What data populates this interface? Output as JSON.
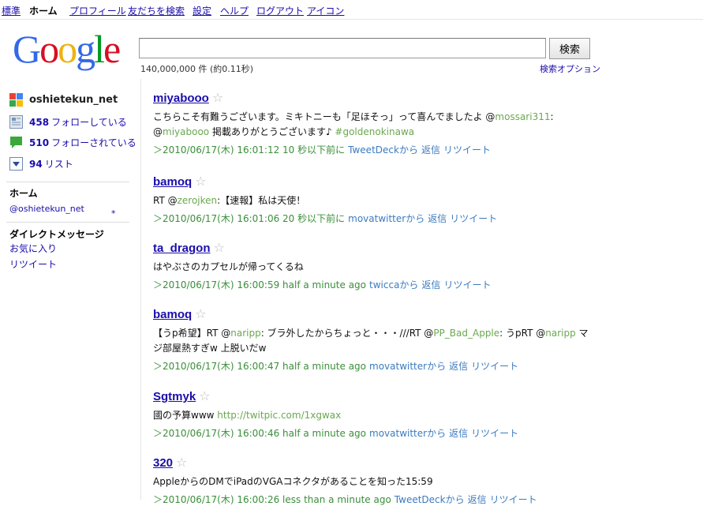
{
  "topnav": [
    "標準",
    "ホーム",
    "プロフィール",
    "友だちを検索",
    "設定",
    "ヘルプ",
    "ログアウト",
    "アイコン"
  ],
  "logo": {
    "letters": [
      "G",
      "o",
      "o",
      "g",
      "l",
      "e"
    ],
    "colors": [
      "#3369e8",
      "#d50f25",
      "#eeb211",
      "#3369e8",
      "#009925",
      "#d50f25"
    ]
  },
  "search": {
    "button": "検索",
    "result_count": "140,000,000 件 (約0.11秒)",
    "options": "検索オプション"
  },
  "sidebar": {
    "username": "oshietekun_net",
    "following_count": "458",
    "following_label": "フォローしている",
    "followers_count": "510",
    "followers_label": "フォローされている",
    "lists_count": "94",
    "lists_label": "リスト",
    "home_head": "ホーム",
    "home_sub": "@oshietekun_net",
    "asterisk": "*",
    "dm_head": "ダイレクトメッセージ",
    "favorites": "お気に入り",
    "retweets": "リツイート"
  },
  "tweets": [
    {
      "user": "miyabooo",
      "text": [
        {
          "t": "こちらこそ有難うございます。ミキトニーも「足ほそっ」って喜んでましたよ @"
        },
        {
          "t": "mossari311",
          "m": 1
        },
        {
          "t": ": @"
        },
        {
          "t": "miyabooo",
          "m": 1
        },
        {
          "t": " 掲載ありがとうございます♪ "
        },
        {
          "t": "#goldenokinawa",
          "m": 1
        }
      ],
      "meta": "＞2010/06/17(木) 16:01:12 10 秒以下前に",
      "source": "TweetDeckから",
      "reply": "返信",
      "retweet": "リツイート"
    },
    {
      "user": "bamoq",
      "text": [
        {
          "t": "RT @"
        },
        {
          "t": "zerojken",
          "m": 1
        },
        {
          "t": ":【速報】私は天使！"
        }
      ],
      "meta": "＞2010/06/17(木) 16:01:06 20 秒以下前に",
      "source": "movatwitterから",
      "reply": "返信",
      "retweet": "リツイート"
    },
    {
      "user": "ta_dragon",
      "text": [
        {
          "t": "はやぶさのカプセルが帰ってくるね"
        }
      ],
      "meta": "＞2010/06/17(木) 16:00:59 half a minute ago",
      "source": "twiccaから",
      "reply": "返信",
      "retweet": "リツイート"
    },
    {
      "user": "bamoq",
      "text": [
        {
          "t": "【うp希望】RT @"
        },
        {
          "t": "naripp",
          "m": 1
        },
        {
          "t": ": ブラ外したからちょっと・・・///RT @"
        },
        {
          "t": "PP_Bad_Apple",
          "m": 1
        },
        {
          "t": ": うpRT @"
        },
        {
          "t": "naripp",
          "m": 1
        },
        {
          "t": " マジ部屋熱すぎw 上脱いだw"
        }
      ],
      "meta": "＞2010/06/17(木) 16:00:47 half a minute ago",
      "source": "movatwitterから",
      "reply": "返信",
      "retweet": "リツイート"
    },
    {
      "user": "Sgtmyk",
      "text": [
        {
          "t": "國の予算www "
        },
        {
          "t": "http://twitpic.com/1xgwax",
          "m": 1
        }
      ],
      "meta": "＞2010/06/17(木) 16:00:46 half a minute ago",
      "source": "movatwitterから",
      "reply": "返信",
      "retweet": "リツイート"
    },
    {
      "user": "320",
      "text": [
        {
          "t": "AppleからのDMでiPadのVGAコネクタがあることを知った15:59"
        }
      ],
      "meta": "＞2010/06/17(木) 16:00:26 less than a minute ago",
      "source": "TweetDeckから",
      "reply": "返信",
      "retweet": "リツイート"
    }
  ]
}
